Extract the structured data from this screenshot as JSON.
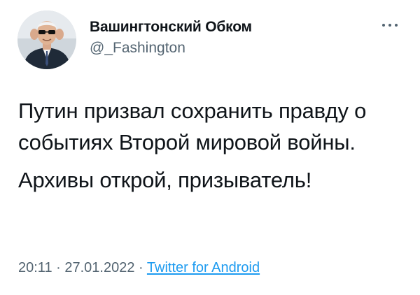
{
  "author": {
    "display_name": "Вашингтонский Обком",
    "handle": "@_Fashington",
    "avatar_icon": "user-avatar-photo"
  },
  "more_icon": "more-horizontal-icon",
  "tweet": {
    "text_line1": "Путин призвал сохранить правду о событиях Второй мировой войны.",
    "text_line2": "Архивы открой, призыватель!"
  },
  "meta": {
    "time": "20:11",
    "separator": "·",
    "date": "27.01.2022",
    "source": "Twitter for Android"
  },
  "colors": {
    "text": "#0f1419",
    "secondary": "#536471",
    "link": "#1d9bf0"
  }
}
